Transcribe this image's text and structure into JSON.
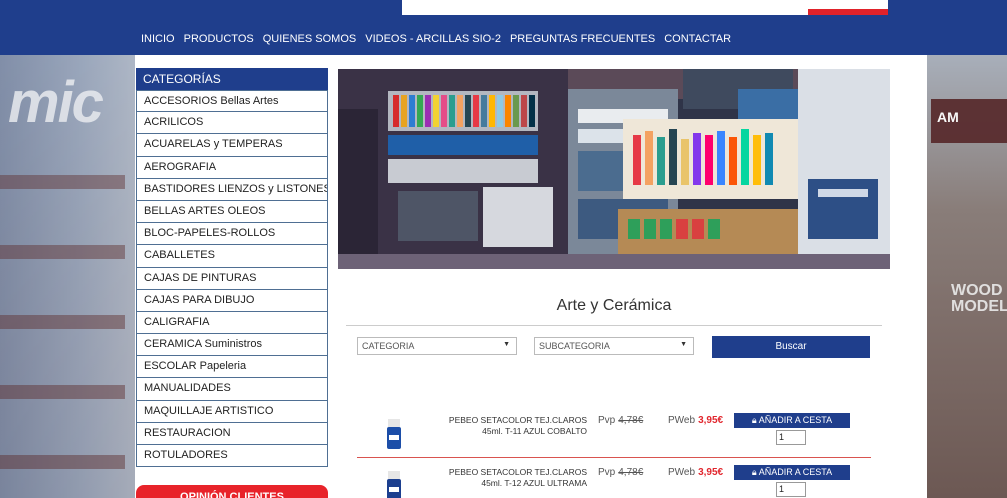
{
  "nav": [
    "INICIO",
    "PRODUCTOS",
    "QUIENES SOMOS",
    "VIDEOS - ARCILLAS SIO-2",
    "PREGUNTAS FRECUENTES",
    "CONTACTAR"
  ],
  "background": {
    "left_text": "mic",
    "right_sign": "AM",
    "right_text": "WOOD MODEL"
  },
  "sidebar": {
    "heading": "CATEGORÍAS",
    "items": [
      "ACCESORIOS Bellas Artes",
      "ACRILICOS",
      "ACUARELAS y TEMPERAS",
      "AEROGRAFIA",
      "BASTIDORES LIENZOS y LISTONES",
      "BELLAS ARTES OLEOS",
      "BLOC-PAPELES-ROLLOS",
      "CABALLETES",
      "CAJAS DE PINTURAS",
      "CAJAS PARA DIBUJO",
      "CALIGRAFIA",
      "CERAMICA Suministros",
      "ESCOLAR Papeleria",
      "MANUALIDADES",
      "MAQUILLAJE ARTISTICO",
      "RESTAURACION",
      "ROTULADORES"
    ],
    "opinion_button": "OPINIÓN CLIENTES"
  },
  "main": {
    "title": "Arte y Cerámica",
    "filters": {
      "categoria": "CATEGORIA",
      "subcategoria": "SUBCATEGORIA",
      "search_button": "Buscar"
    },
    "products": [
      {
        "desc": "PEBEO SETACOLOR TEJ.CLAROS 45ml. T-11 AZUL COBALTO",
        "pvp_label": "Pvp",
        "pvp": "4,78€",
        "pweb_label": "PWeb",
        "pweb": "3,95€",
        "cart": "AÑADIR A CESTA",
        "qty": "1"
      },
      {
        "desc": "PEBEO SETACOLOR TEJ.CLAROS 45ml. T-12 AZUL ULTRAMA",
        "pvp_label": "Pvp",
        "pvp": "4,78€",
        "pweb_label": "PWeb",
        "pweb": "3,95€",
        "cart": "AÑADIR A CESTA",
        "qty": "1"
      }
    ]
  },
  "colors": {
    "primary": "#1f3e8c",
    "accent": "#e1262d"
  },
  "icons": {
    "cart": "lock-bag-icon"
  }
}
